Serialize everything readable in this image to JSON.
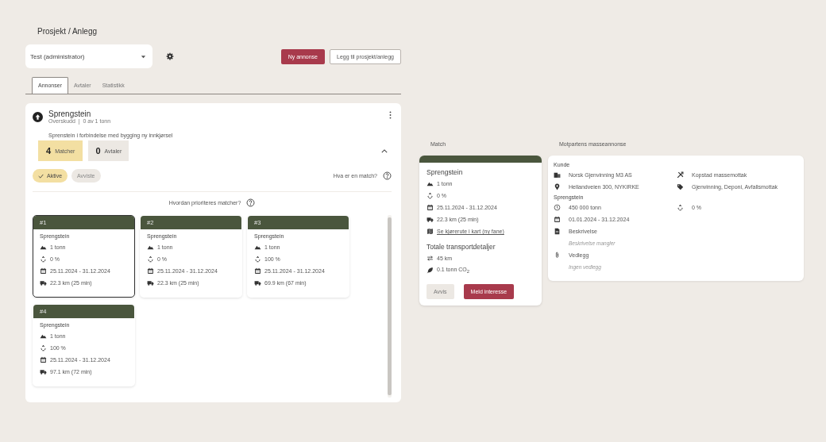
{
  "page_title": "Prosjekt / Anlegg",
  "project_select": {
    "value": "Test (administrator)"
  },
  "header_buttons": [
    {
      "label": "Ny annonse",
      "kind": "primary"
    },
    {
      "label": "Legg til prosjekt/anlegg",
      "kind": "outline"
    }
  ],
  "tabs": [
    {
      "label": "Annonser",
      "selected": true
    },
    {
      "label": "Avtaler",
      "selected": false
    },
    {
      "label": "Statistikk",
      "selected": false
    }
  ],
  "listing": {
    "title": "Sprengstein",
    "subtitle": "Overskudd  |  0 av 1 tonn",
    "description": "Sprenstein i forbindelse med bygging ny innkjørsel",
    "expanded": true,
    "counters": [
      {
        "count": "4",
        "label": "Matcher",
        "selected": true
      },
      {
        "count": "0",
        "label": "Avtaler",
        "selected": false
      }
    ],
    "filters": [
      {
        "label": "Aktive",
        "selected": true
      },
      {
        "label": "Avviste",
        "selected": false
      }
    ],
    "help_link": "Hva er en match?",
    "priority_link": "Hvordan prioriteres matcher?",
    "matches": [
      {
        "rank": "#1",
        "title": "Sprengstein",
        "quantity": "1 tonn",
        "recycled": "0 %",
        "period": "25.11.2024 - 31.12.2024",
        "distance": "22.3 km (25 min)",
        "selected": true
      },
      {
        "rank": "#2",
        "title": "Sprengstein",
        "quantity": "1 tonn",
        "recycled": "0 %",
        "period": "25.11.2024 - 31.12.2024",
        "distance": "22.3 km (25 min)",
        "selected": false
      },
      {
        "rank": "#3",
        "title": "Sprengstein",
        "quantity": "1 tonn",
        "recycled": "100 %",
        "period": "25.11.2024 - 31.12.2024",
        "distance": "69.9 km (67 min)",
        "selected": false
      },
      {
        "rank": "#4",
        "title": "Sprengstein",
        "quantity": "1 tonn",
        "recycled": "100 %",
        "period": "25.11.2024 - 31.12.2024",
        "distance": "97.1 km (72 min)",
        "selected": false
      }
    ]
  },
  "match": {
    "heading": "Match",
    "title": "Sprengstein",
    "quantity": "1 tonn",
    "recycled": "0 %",
    "period": "25.11.2024 - 31.12.2024",
    "distance": "22.3 km (25 min)",
    "route_link": "Se kjørerute i kart (ny fane)",
    "transport_heading": "Totale transportdetaljer",
    "total_distance": "45 km",
    "emissions": "0.1 tonn CO$_{2}$",
    "buttons": [
      {
        "label": "Avvis",
        "kind": "secondary"
      },
      {
        "label": "Meld interesse",
        "kind": "primary"
      }
    ]
  },
  "counterpart": {
    "heading": "Motpartens masseannonse",
    "customer_heading": "Kunde",
    "company": "Norsk Gjenvinning M3 AS",
    "site": "Kopstad massemottak",
    "address": "Hellandveien 300, NYKIRKE",
    "categories": "Gjenvinning, Deponi, Avfallsmottak",
    "mass_heading": "Sprengstein",
    "volume": "450 000 tonn",
    "recycled": "0 %",
    "period": "01.01.2024 - 31.12.2024",
    "description_heading": "Beskrivelse",
    "description_value": "Beskrivelse mangler",
    "attachments_heading": "Vedlegg",
    "attachments_value": "Ingen vedlegg"
  }
}
